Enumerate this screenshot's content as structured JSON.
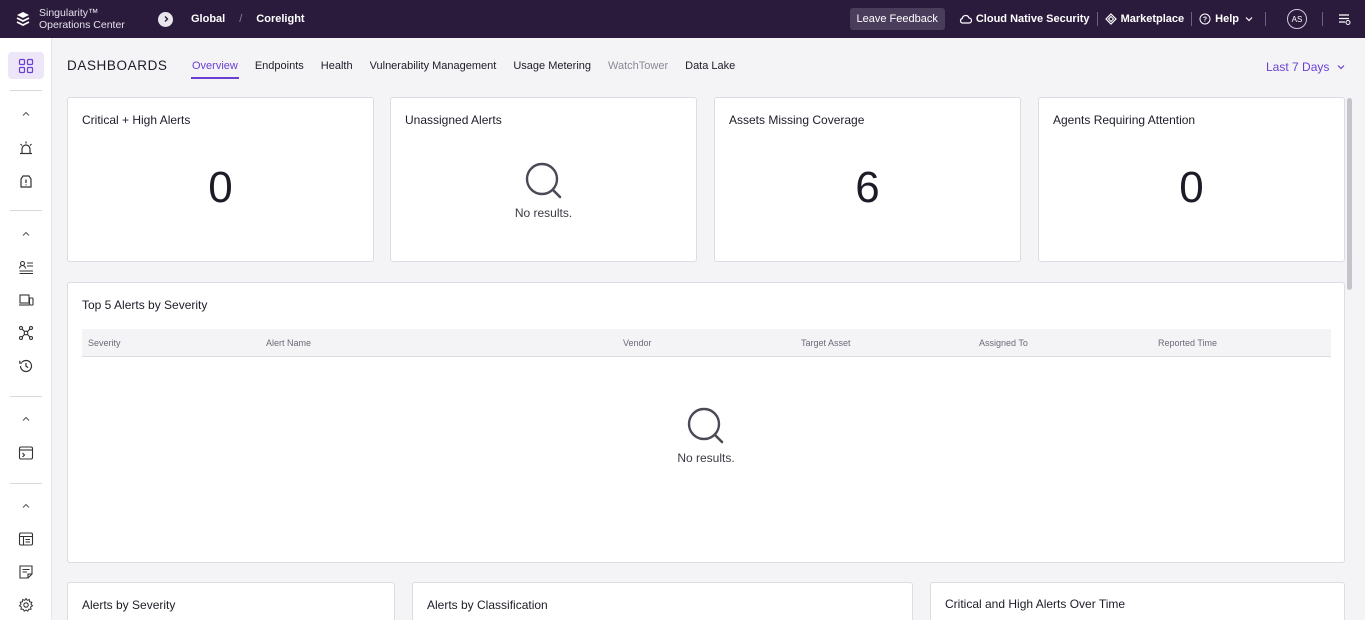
{
  "header": {
    "product_name": "Singularity™",
    "product_sub": "Operations Center",
    "breadcrumbs": [
      "Global",
      "Corelight"
    ],
    "feedback_label": "Leave Feedback",
    "links": [
      "Cloud Native Security",
      "Marketplace",
      "Help"
    ],
    "avatar_initials": "AS"
  },
  "page": {
    "title": "DASHBOARDS",
    "tabs": [
      {
        "label": "Overview"
      },
      {
        "label": "Endpoints"
      },
      {
        "label": "Health"
      },
      {
        "label": "Vulnerability Management"
      },
      {
        "label": "Usage Metering"
      },
      {
        "label": "WatchTower"
      },
      {
        "label": "Data Lake"
      }
    ],
    "active_tab": "Overview",
    "time_range": "Last 7 Days"
  },
  "cards": {
    "critical_high": {
      "title": "Critical + High Alerts",
      "value": "0"
    },
    "unassigned": {
      "title": "Unassigned Alerts",
      "empty_text": "No results."
    },
    "missing_coverage": {
      "title": "Assets Missing Coverage",
      "value": "6"
    },
    "agents_attention": {
      "title": "Agents Requiring Attention",
      "value": "0"
    }
  },
  "top_alerts": {
    "title": "Top 5 Alerts by Severity",
    "columns": [
      "Severity",
      "Alert Name",
      "Vendor",
      "Target Asset",
      "Assigned To",
      "Reported Time"
    ],
    "empty_text": "No results."
  },
  "bottom_cards": {
    "by_severity": "Alerts by Severity",
    "by_classification": "Alerts by Classification",
    "over_time": "Critical and High Alerts Over Time"
  },
  "colors": {
    "topbar": "#2a1b3d",
    "accent": "#6b3fd4"
  }
}
